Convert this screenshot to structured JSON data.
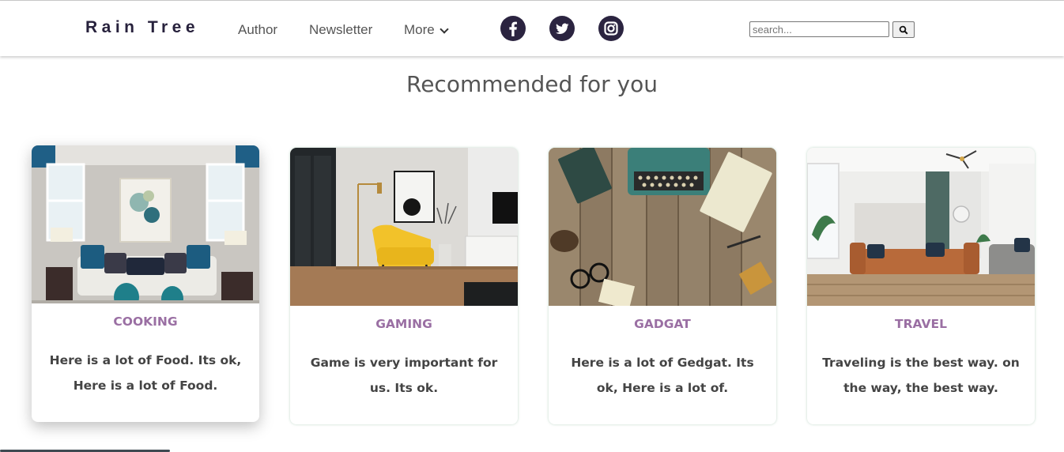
{
  "header": {
    "logo": "Rain Tree",
    "nav": [
      {
        "label": "Author"
      },
      {
        "label": "Newsletter"
      },
      {
        "label": "More"
      }
    ],
    "social": [
      "facebook-icon",
      "twitter-icon",
      "instagram-icon"
    ],
    "search": {
      "placeholder": "search...",
      "value": ""
    }
  },
  "main": {
    "heading": "Recommended for you",
    "cards": [
      {
        "category": "COOKING",
        "description": "Here is a lot of Food. Its ok, Here is a lot of Food."
      },
      {
        "category": "GAMING",
        "description": "Game is very important for us. Its ok."
      },
      {
        "category": "GADGAT",
        "description": "Here is a lot of Gedgat. Its ok, Here is a lot of."
      },
      {
        "category": "TRAVEL",
        "description": "Traveling is the best way. on the way, the best way."
      }
    ]
  },
  "colors": {
    "brand": "#2b2440",
    "category": "#9a6fa3",
    "heading": "#555555"
  }
}
